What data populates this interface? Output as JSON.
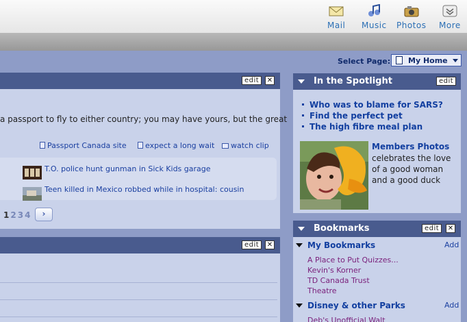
{
  "toolbar": {
    "items": [
      {
        "label": "Mail",
        "icon": "mail-icon"
      },
      {
        "label": "Music",
        "icon": "music-icon"
      },
      {
        "label": "Photos",
        "icon": "photos-icon"
      },
      {
        "label": "More",
        "icon": "more-icon"
      }
    ]
  },
  "select_page": {
    "label": "Select Page:",
    "value": "My Home"
  },
  "news_panel": {
    "edit_label": "edit",
    "close_label": "✕",
    "snippet": "a passport to fly to either country; you may have yours, but the great",
    "links": [
      "Passport Canada site",
      "expect a long wait",
      "watch clip"
    ],
    "stories": [
      "T.O. police hunt gunman in Sick Kids garage",
      "Teen killed in Mexico robbed while in hospital: cousin"
    ],
    "pages": [
      "1",
      "2",
      "3",
      "4"
    ],
    "next_label": "›"
  },
  "second_panel": {
    "edit_label": "edit",
    "close_label": "✕"
  },
  "spotlight": {
    "title": "In the Spotlight",
    "edit_label": "edit",
    "links": [
      "Who was to blame for SARS?",
      "Find the perfect pet",
      "The high fibre meal plan"
    ],
    "photo_title": "Members Photos",
    "photo_desc": "celebrates the love of a good woman and a good duck"
  },
  "bookmarks": {
    "title": "Bookmarks",
    "edit_label": "edit",
    "close_label": "✕",
    "groups": [
      {
        "name": "My Bookmarks",
        "add_label": "Add",
        "items": [
          "A Place to Put Quizzes...",
          "Kevin's Korner",
          "TD Canada Trust",
          "Theatre"
        ]
      },
      {
        "name": "Disney & other Parks",
        "add_label": "Add",
        "items": [
          "Deb's Unofficial Walt"
        ]
      }
    ]
  },
  "colors": {
    "background": "#8e9cc7",
    "panel_header": "#495b8e",
    "panel_body": "#c9d2ea",
    "link": "#123fa0",
    "visited_link": "#7a1f7a"
  }
}
